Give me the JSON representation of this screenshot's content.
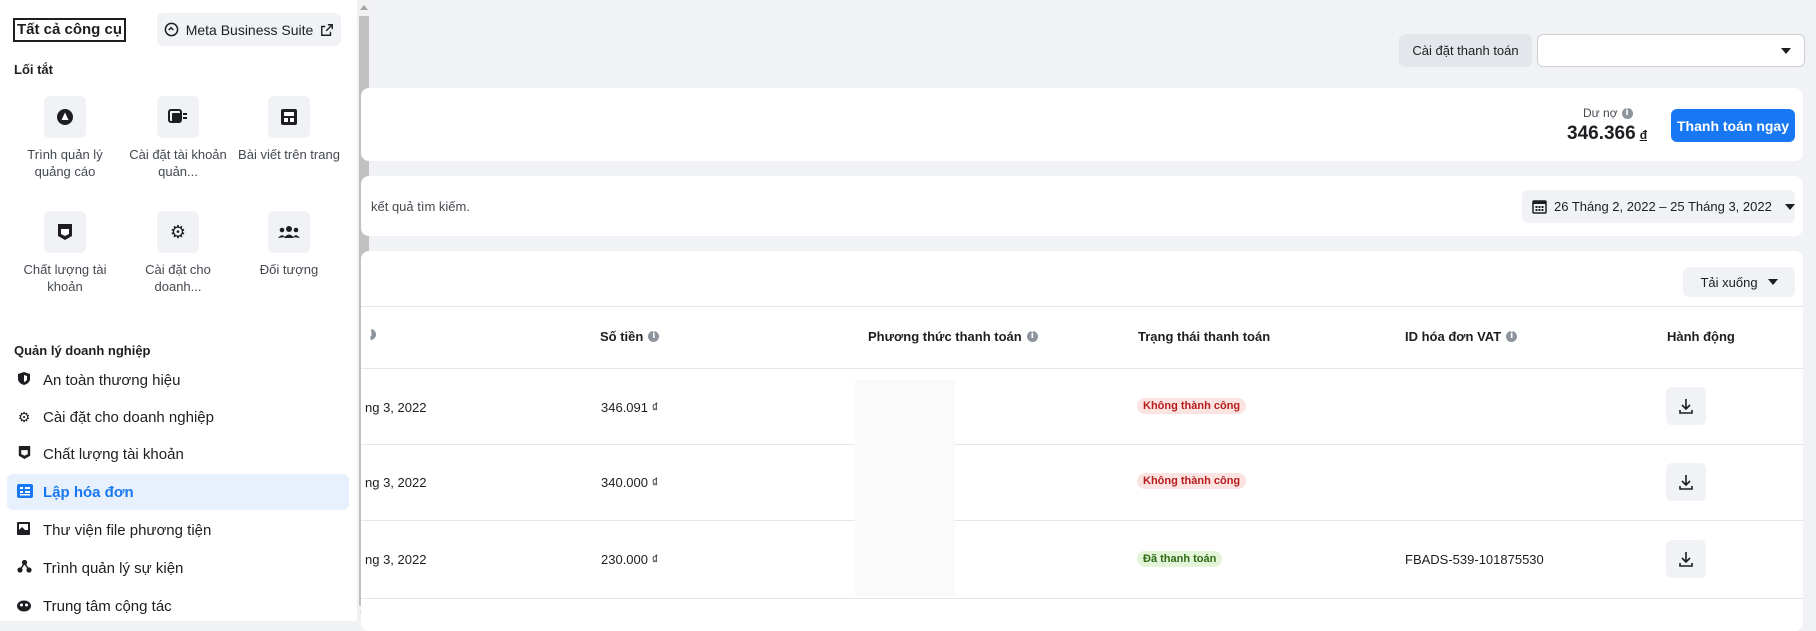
{
  "sidebar": {
    "title": "Tất cả công cụ",
    "mbs_button": "Meta Business Suite",
    "shortcuts_label": "Lối tắt",
    "shortcuts": [
      {
        "label": "Trình quản lý quảng cáo",
        "icon": "ads-manager-icon"
      },
      {
        "label": "Cài đặt tài khoản quản...",
        "icon": "ad-account-settings-icon"
      },
      {
        "label": "Bài viết trên trang",
        "icon": "page-posts-icon"
      },
      {
        "label": "Chất lượng tài khoản",
        "icon": "account-quality-icon"
      },
      {
        "label": "Cài đặt cho doanh...",
        "icon": "gear-icon"
      },
      {
        "label": "Đối tượng",
        "icon": "audiences-icon"
      }
    ],
    "business_label": "Quản lý doanh nghiệp",
    "items": [
      {
        "label": "An toàn thương hiệu",
        "icon": "shield-icon"
      },
      {
        "label": "Cài đặt cho doanh nghiệp",
        "icon": "gear-icon"
      },
      {
        "label": "Chất lượng tài khoản",
        "icon": "account-quality-icon"
      },
      {
        "label": "Lập hóa đơn",
        "icon": "billing-icon",
        "active": true
      },
      {
        "label": "Thư viện file phương tiện",
        "icon": "media-library-icon"
      },
      {
        "label": "Trình quản lý sự kiện",
        "icon": "events-manager-icon"
      },
      {
        "label": "Trung tâm cộng tác",
        "icon": "collab-center-icon"
      }
    ]
  },
  "header": {
    "payment_settings": "Cài đặt thanh toán"
  },
  "balance": {
    "label": "Dư nợ",
    "value": "346.366",
    "currency": "đ",
    "pay_now": "Thanh toán ngay"
  },
  "filter": {
    "search_text": "kết quả tìm kiếm.",
    "date_range": "26 Tháng 2, 2022 – 25 Tháng 3, 2022"
  },
  "table": {
    "download_label": "Tải xuống",
    "headers": {
      "amount": "Số tiền",
      "payment_method": "Phương thức thanh toán",
      "payment_status": "Trạng thái thanh toán",
      "vat_id": "ID hóa đơn VAT",
      "actions": "Hành động"
    },
    "rows": [
      {
        "date": "ng 3, 2022",
        "amount": "346.091 ₫",
        "status": "Không thành công",
        "status_type": "fail",
        "vat_id": ""
      },
      {
        "date": "ng 3, 2022",
        "amount": "340.000 ₫",
        "status": "Không thành công",
        "status_type": "fail",
        "vat_id": ""
      },
      {
        "date": "ng 3, 2022",
        "amount": "230.000 ₫",
        "status": "Đã thanh toán",
        "status_type": "ok",
        "vat_id": "FBADS-539-101875530"
      }
    ]
  },
  "colors": {
    "accent": "#1877f2",
    "fail_bg": "#fbe3e1",
    "ok_bg": "#e3f4d9"
  }
}
